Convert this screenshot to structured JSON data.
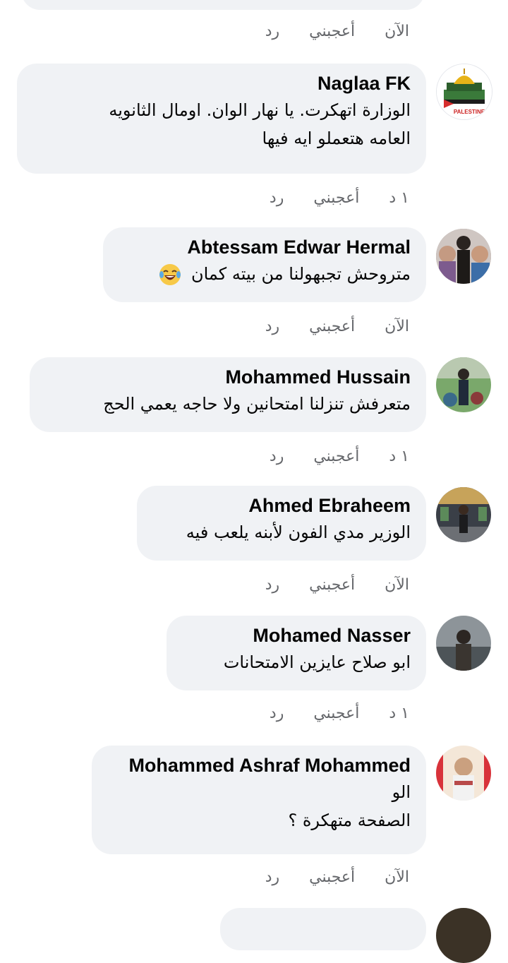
{
  "comments": [
    {
      "author": "Naglaa FK",
      "lines": [
        "الوزارة اتهكرت. يا نهار الوان. اومال الثانويه",
        "العامه هتعملو ايه فيها"
      ],
      "time": "١ د",
      "like": "أعجبني",
      "reply": "رد",
      "avatar_badge": "PALESTINE"
    },
    {
      "author": "Abtessam Edwar Hermal",
      "lines": [
        "متروحش تجبهولنا من بيته كمان"
      ],
      "emoji": "laughing-crying-face",
      "time": "الآن",
      "like": "أعجبني",
      "reply": "رد"
    },
    {
      "author": "Mohammed Hussain",
      "lines": [
        "متعرفش تنزلنا امتحانين ولا حاجه يعمي الحج"
      ],
      "time": "١ د",
      "like": "أعجبني",
      "reply": "رد"
    },
    {
      "author": "Ahmed Ebraheem",
      "lines": [
        "الوزير مدي الفون لأبنه يلعب فيه"
      ],
      "time": "الآن",
      "like": "أعجبني",
      "reply": "رد"
    },
    {
      "author": "Mohamed Nasser",
      "lines": [
        "ابو صلاح عايزين الامتحانات"
      ],
      "time": "١ د",
      "like": "أعجبني",
      "reply": "رد"
    },
    {
      "author": "Mohammed Ashraf Mohammed",
      "lines": [
        "الو",
        "الصفحة متهكرة ؟"
      ],
      "time": "الآن",
      "like": "أعجبني",
      "reply": "رد"
    }
  ],
  "top_partial_actions": {
    "time": "الآن",
    "like": "أعجبني",
    "reply": "رد"
  },
  "colors": {
    "bubble": "#f0f2f5",
    "meta_text": "#65676b",
    "name_text": "#050505"
  }
}
